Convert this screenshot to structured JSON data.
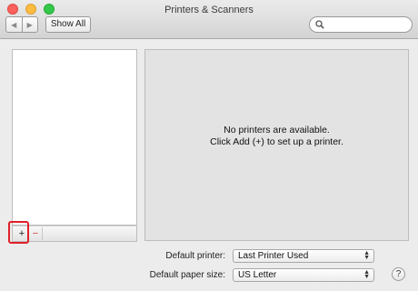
{
  "window": {
    "title": "Printers & Scanners"
  },
  "toolbar": {
    "back_icon": "◀",
    "forward_icon": "▶",
    "show_all_label": "Show All",
    "search_placeholder": ""
  },
  "printer_list": {
    "add_label": "+",
    "remove_label": "−"
  },
  "info_panel": {
    "message_line1": "No printers are available.",
    "message_line2": "Click Add (+) to set up a printer."
  },
  "default_printer": {
    "label": "Default printer:",
    "value": "Last Printer Used"
  },
  "default_paper": {
    "label": "Default paper size:",
    "value": "US Letter"
  },
  "help": {
    "label": "?"
  },
  "colors": {
    "highlight": "#e0202a",
    "close": "#fc605c",
    "minimize": "#fdbc40",
    "zoom": "#34c84a"
  }
}
